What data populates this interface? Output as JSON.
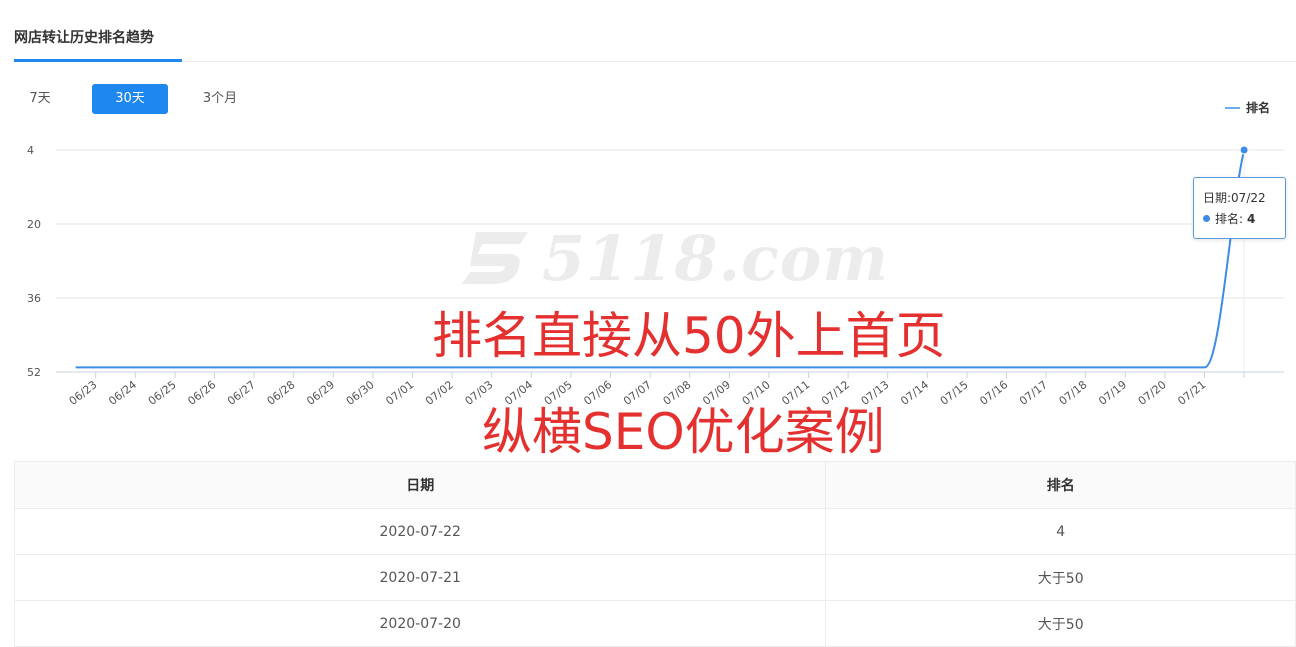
{
  "header": {
    "title": "网店转让历史排名趋势"
  },
  "tabs": [
    {
      "label": "7天",
      "active": false
    },
    {
      "label": "30天",
      "active": true
    },
    {
      "label": "3个月",
      "active": false
    }
  ],
  "tooltip": {
    "date_label": "日期:07/22",
    "series_label": "排名:",
    "value": "4"
  },
  "watermark": "5118.com",
  "overlay": {
    "line1": "排名直接从50外上首页",
    "line2": "纵横SEO优化案例"
  },
  "chart_data": {
    "type": "line",
    "categories": [
      "06/23",
      "06/24",
      "06/25",
      "06/26",
      "06/27",
      "06/28",
      "06/29",
      "06/30",
      "07/01",
      "07/02",
      "07/03",
      "07/04",
      "07/05",
      "07/06",
      "07/07",
      "07/08",
      "07/09",
      "07/10",
      "07/11",
      "07/12",
      "07/13",
      "07/14",
      "07/15",
      "07/16",
      "07/17",
      "07/18",
      "07/19",
      "07/20",
      "07/21",
      "07/22"
    ],
    "series": [
      {
        "name": "排名",
        "values": [
          51,
          51,
          51,
          51,
          51,
          51,
          51,
          51,
          51,
          51,
          51,
          51,
          51,
          51,
          51,
          51,
          51,
          51,
          51,
          51,
          51,
          51,
          51,
          51,
          51,
          51,
          51,
          51,
          51,
          4
        ]
      }
    ],
    "yticks": [
      4,
      20,
      36,
      52
    ],
    "ylim": [
      4,
      52
    ],
    "y_inverted": true,
    "grid": true,
    "legend": "top-right",
    "line_color": "#3d8ce6"
  },
  "table": {
    "headers": [
      "日期",
      "排名"
    ],
    "rows": [
      [
        "2020-07-22",
        "4"
      ],
      [
        "2020-07-21",
        "大于50"
      ],
      [
        "2020-07-20",
        "大于50"
      ]
    ]
  }
}
